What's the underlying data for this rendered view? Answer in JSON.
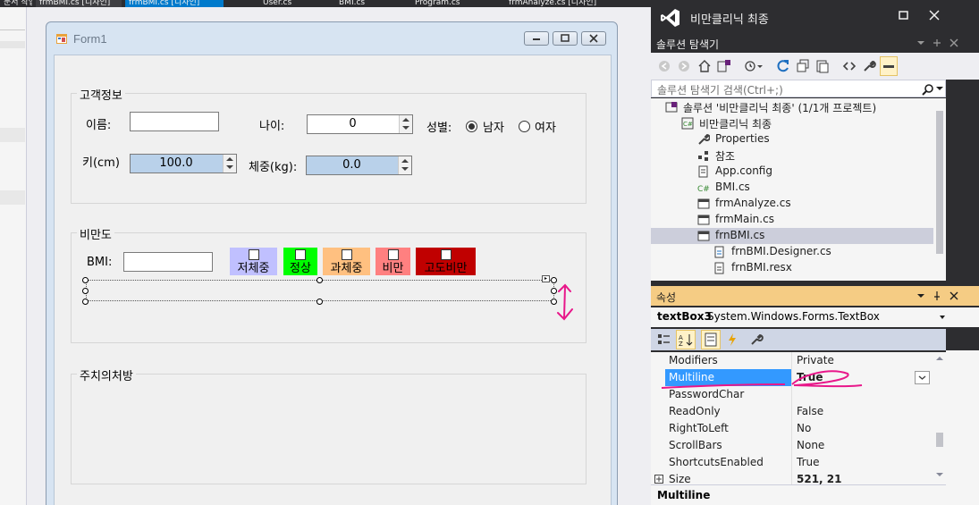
{
  "tabs": [
    "문서 작업",
    "frmBMI.cs [디자인]",
    "User.cs",
    "BMI.cs",
    "Program.cs",
    "frmAnalyze.cs [디자인]"
  ],
  "form": {
    "title": "Form1",
    "customer_group": {
      "title": "고객정보",
      "name_label": "이름:",
      "age_label": "나이:",
      "age_value": "0",
      "gender_label": "성별:",
      "male_label": "남자",
      "female_label": "여자",
      "height_label": "키(cm)",
      "height_value": "100.0",
      "weight_label": "체중(kg):",
      "weight_value": "0.0"
    },
    "obesity_group": {
      "title": "비만도",
      "bmi_label": "BMI:",
      "categories": [
        {
          "label": "저체중",
          "color": "#c0c0ff"
        },
        {
          "label": "정상",
          "color": "#00ff00"
        },
        {
          "label": "과체중",
          "color": "#ffc080"
        },
        {
          "label": "비만",
          "color": "#ff8080"
        },
        {
          "label": "고도비만",
          "color": "#c00000"
        }
      ]
    },
    "advice_group": {
      "title": "주치의처방"
    }
  },
  "ide": {
    "window_title": "비만클리닉 최종",
    "solution_explorer": {
      "title": "솔루션 탐색기",
      "search_placeholder": "솔루션 탐색기 검색(Ctrl+;)",
      "solution": "솔루션 '비만클리닉 최종' (1/1개 프로젝트)",
      "project": "비만클리닉 최종",
      "items": [
        "Properties",
        "참조",
        "App.config",
        "BMI.cs",
        "frmAnalyze.cs",
        "frmMain.cs",
        "frnBMI.cs",
        "frnBMI.Designer.cs",
        "frnBMI.resx"
      ]
    },
    "properties": {
      "title": "속성",
      "object_name": "textBox3",
      "object_type": "System.Windows.Forms.TextBox",
      "rows": [
        {
          "name": "Modifiers",
          "value": "Private"
        },
        {
          "name": "Multiline",
          "value": "True"
        },
        {
          "name": "PasswordChar",
          "value": ""
        },
        {
          "name": "ReadOnly",
          "value": "False"
        },
        {
          "name": "RightToLeft",
          "value": "No"
        },
        {
          "name": "ScrollBars",
          "value": "None"
        },
        {
          "name": "ShortcutsEnabled",
          "value": "True"
        },
        {
          "name": "Size",
          "value": "521, 21"
        }
      ],
      "description_title": "Multiline"
    }
  },
  "colors": {
    "annotation": "#e8178a",
    "selection": "#3399ff",
    "accent": "#68217a"
  }
}
